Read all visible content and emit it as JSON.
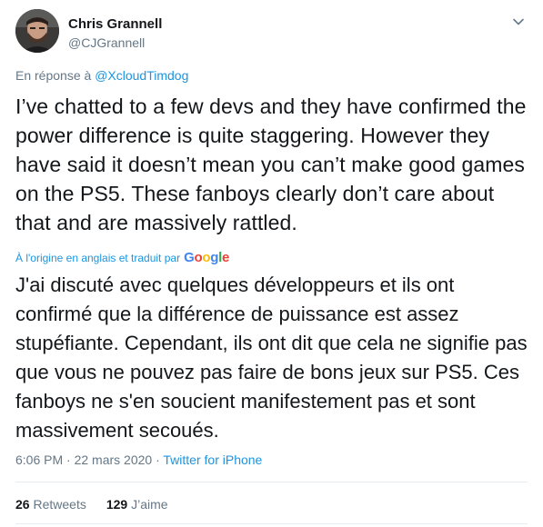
{
  "author": {
    "display_name": "Chris Grannell",
    "handle": "@CJGrannell"
  },
  "reply": {
    "prefix": "En réponse à",
    "mention": "@XcloudTimdog"
  },
  "tweet": {
    "text": "I’ve chatted to a few devs and they have confirmed the power difference is quite staggering. However they have said it doesn’t mean you can’t make good games on the PS5. These fanboys clearly don’t care about that and are massively rattled."
  },
  "translation": {
    "label": "À l'origine en anglais et traduit par",
    "provider": "Google",
    "text": "J'ai discuté avec quelques développeurs et ils ont confirmé que la différence de puissance est assez stupéfiante. Cependant, ils ont dit que cela ne signifie pas que vous ne pouvez pas faire de bons jeux sur PS5. Ces fanboys ne s'en soucient manifestement pas et sont massivement secoués."
  },
  "meta": {
    "time": "6:06 PM",
    "separator": "·",
    "date": "22 mars 2020",
    "source": "Twitter for iPhone"
  },
  "stats": {
    "retweets_count": "26",
    "retweets_label": "Retweets",
    "likes_count": "129",
    "likes_label": "J’aime"
  },
  "icons": {
    "caret": "chevron-down-icon",
    "avatar": "avatar"
  },
  "colors": {
    "link": "#1b95e0",
    "secondary_text": "#657786",
    "primary_text": "#14171a",
    "divider": "#e6ecf0"
  }
}
